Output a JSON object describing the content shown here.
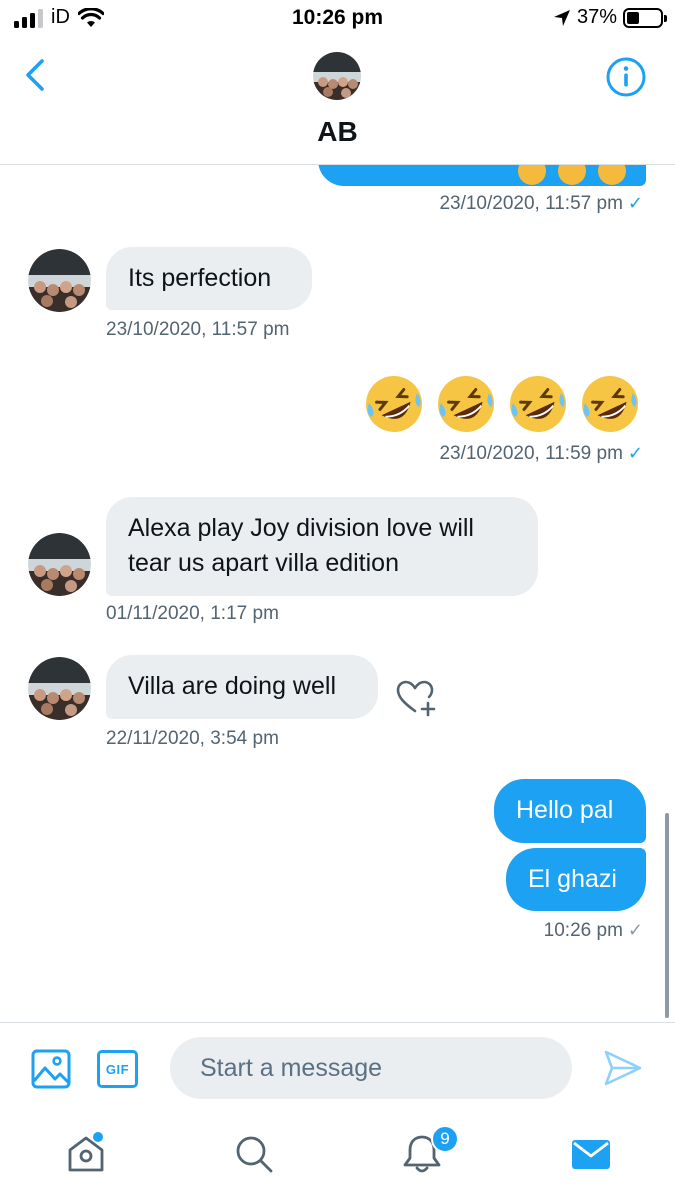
{
  "status_bar": {
    "carrier": "iD",
    "time": "10:26 pm",
    "battery_percent": "37%",
    "battery_level": 0.37
  },
  "header": {
    "title": "AB"
  },
  "messages": [
    {
      "direction": "outgoing",
      "meta": "23/10/2020, 11:57 pm",
      "status": "✓"
    },
    {
      "direction": "incoming",
      "text": "Its perfection",
      "meta": "23/10/2020, 11:57 pm"
    },
    {
      "direction": "outgoing",
      "text": "🤣🤣🤣🤣",
      "meta": "23/10/2020, 11:59 pm",
      "status": "✓"
    },
    {
      "direction": "incoming",
      "text": "Alexa play Joy division love will tear us apart villa edition",
      "meta": "01/11/2020, 1:17 pm"
    },
    {
      "direction": "incoming",
      "text": "Villa are doing well",
      "meta": "22/11/2020, 3:54 pm"
    },
    {
      "direction": "outgoing",
      "text": "Hello pal"
    },
    {
      "direction": "outgoing",
      "text": "El ghazi",
      "meta": "10:26 pm",
      "status": "✓"
    }
  ],
  "composer": {
    "gif_label": "GIF",
    "placeholder": "Start a message"
  },
  "tabs": {
    "notifications_badge": "9"
  },
  "colors": {
    "accent": "#1da1f2",
    "incoming_bubble": "#ebeef0",
    "meta_text": "#536471"
  },
  "icons": [
    "back-chevron-icon",
    "info-icon",
    "image-icon",
    "gif-icon",
    "send-icon",
    "home-icon",
    "search-icon",
    "bell-icon",
    "mail-icon",
    "heart-plus-icon",
    "rofl-emoji-icon"
  ]
}
